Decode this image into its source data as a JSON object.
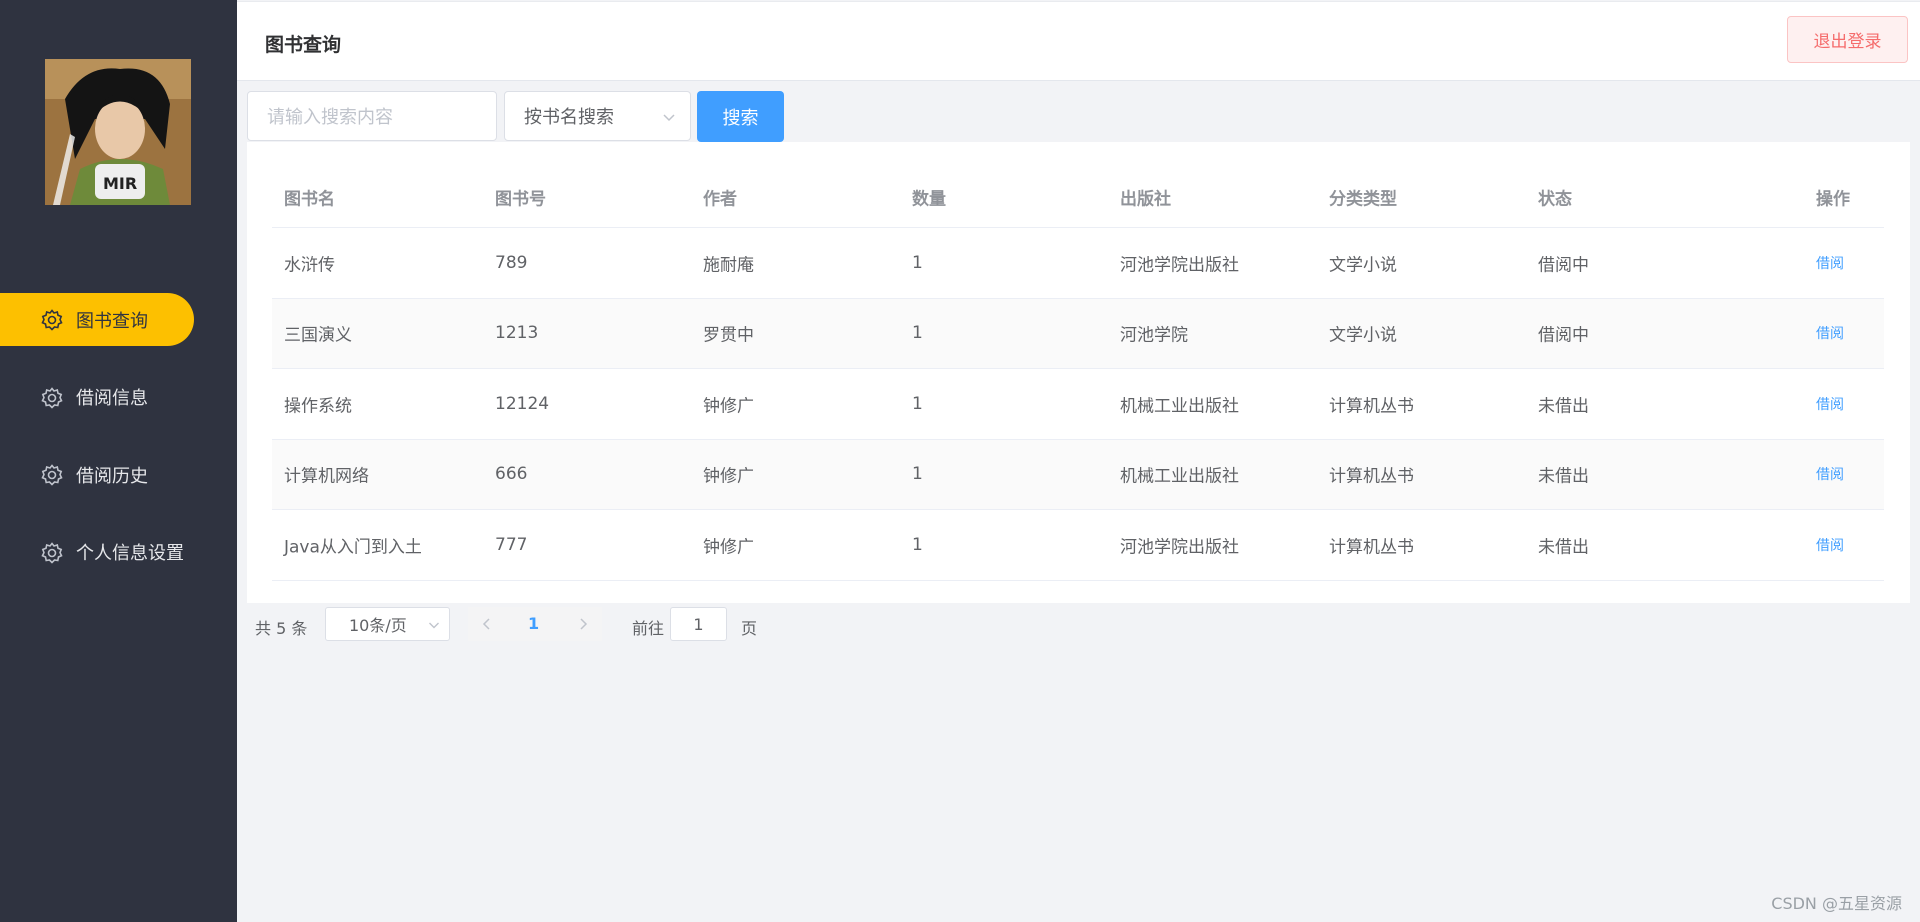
{
  "sidebar": {
    "items": [
      {
        "label": "图书查询",
        "icon": "gear-icon",
        "active": true
      },
      {
        "label": "借阅信息",
        "icon": "gear-icon",
        "active": false
      },
      {
        "label": "借阅历史",
        "icon": "gear-icon",
        "active": false
      },
      {
        "label": "个人信息设置",
        "icon": "gear-icon",
        "active": false
      }
    ]
  },
  "header": {
    "title": "图书查询",
    "logout_label": "退出登录"
  },
  "search": {
    "placeholder": "请输入搜索内容",
    "select_value": "按书名搜索",
    "button_label": "搜索"
  },
  "table": {
    "columns": [
      "图书名",
      "图书号",
      "作者",
      "数量",
      "出版社",
      "分类类型",
      "状态",
      "操作"
    ],
    "rows": [
      {
        "name": "水浒传",
        "id": "789",
        "author": "施耐庵",
        "qty": "1",
        "publisher": "河池学院出版社",
        "category": "文学小说",
        "status": "借阅中",
        "action": "借阅"
      },
      {
        "name": "三国演义",
        "id": "1213",
        "author": "罗贯中",
        "qty": "1",
        "publisher": "河池学院",
        "category": "文学小说",
        "status": "借阅中",
        "action": "借阅"
      },
      {
        "name": "操作系统",
        "id": "12124",
        "author": "钟修广",
        "qty": "1",
        "publisher": "机械工业出版社",
        "category": "计算机丛书",
        "status": "未借出",
        "action": "借阅"
      },
      {
        "name": "计算机网络",
        "id": "666",
        "author": "钟修广",
        "qty": "1",
        "publisher": "机械工业出版社",
        "category": "计算机丛书",
        "status": "未借出",
        "action": "借阅"
      },
      {
        "name": "Java从入门到入土",
        "id": "777",
        "author": "钟修广",
        "qty": "1",
        "publisher": "河池学院出版社",
        "category": "计算机丛书",
        "status": "未借出",
        "action": "借阅"
      }
    ]
  },
  "pagination": {
    "total_text": "共 5 条",
    "page_size": "10条/页",
    "current_page": "1",
    "goto_label": "前往",
    "jump_value": "1",
    "page_suffix": "页"
  },
  "watermark": "CSDN @五星资源",
  "colors": {
    "sidebar_bg": "#2f3340",
    "active_item": "#fdc000",
    "primary": "#409eff",
    "danger": "#f56c6c"
  }
}
